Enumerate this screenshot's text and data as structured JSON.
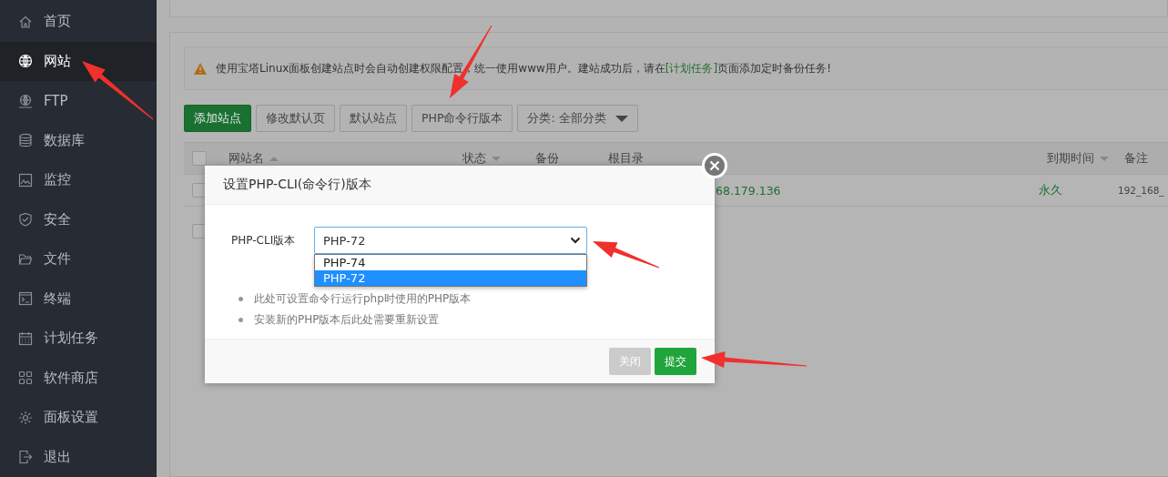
{
  "sidebar": {
    "items": [
      {
        "label": "首页",
        "selected": false
      },
      {
        "label": "网站",
        "selected": true
      },
      {
        "label": "FTP",
        "selected": false
      },
      {
        "label": "数据库",
        "selected": false
      },
      {
        "label": "监控",
        "selected": false
      },
      {
        "label": "安全",
        "selected": false
      },
      {
        "label": "文件",
        "selected": false
      },
      {
        "label": "终端",
        "selected": false
      },
      {
        "label": "计划任务",
        "selected": false
      },
      {
        "label": "软件商店",
        "selected": false
      },
      {
        "label": "面板设置",
        "selected": false
      },
      {
        "label": "退出",
        "selected": false
      }
    ]
  },
  "notice": {
    "before": "使用宝塔Linux面板创建站点时会自动创建权限配置，统一使用www用户。建站成功后，请在",
    "link": "[计划任务]",
    "after": "页面添加定时备份任务!"
  },
  "toolbar": [
    {
      "label": "添加站点",
      "kind": "primary"
    },
    {
      "label": "修改默认页",
      "kind": "default"
    },
    {
      "label": "默认站点",
      "kind": "default"
    },
    {
      "label": "PHP命令行版本",
      "kind": "default"
    },
    {
      "label": "分类: 全部分类",
      "kind": "dropdown"
    }
  ],
  "table": {
    "columns": [
      {
        "label": "网站名",
        "sortable": true,
        "ascending": true
      },
      {
        "label": "状态",
        "sortable": true,
        "ascending": false
      },
      {
        "label": "备份",
        "sortable": false
      },
      {
        "label": "根目录",
        "sortable": false
      },
      {
        "label": "到期时间",
        "sortable": true,
        "ascending": false
      },
      {
        "label": "备注",
        "sortable": false
      }
    ],
    "header_checked": false,
    "rows": [
      {
        "checked": false,
        "root": "68.179.136",
        "expiry": "永久",
        "note": "192_168_"
      }
    ],
    "footer_checked": false
  },
  "dialog": {
    "title": "设置PHP-CLI(命令行)版本",
    "field_label": "PHP-CLI版本",
    "value": "PHP-72",
    "options": [
      {
        "label": "PHP-74",
        "selected": false
      },
      {
        "label": "PHP-72",
        "selected": true
      }
    ],
    "notes": [
      "此处可设置命令行运行php时使用的PHP版本",
      "安装新的PHP版本后此处需要重新设置"
    ],
    "buttons": [
      {
        "label": "关闭",
        "kind": "secondary"
      },
      {
        "label": "提交",
        "kind": "primary"
      }
    ]
  }
}
